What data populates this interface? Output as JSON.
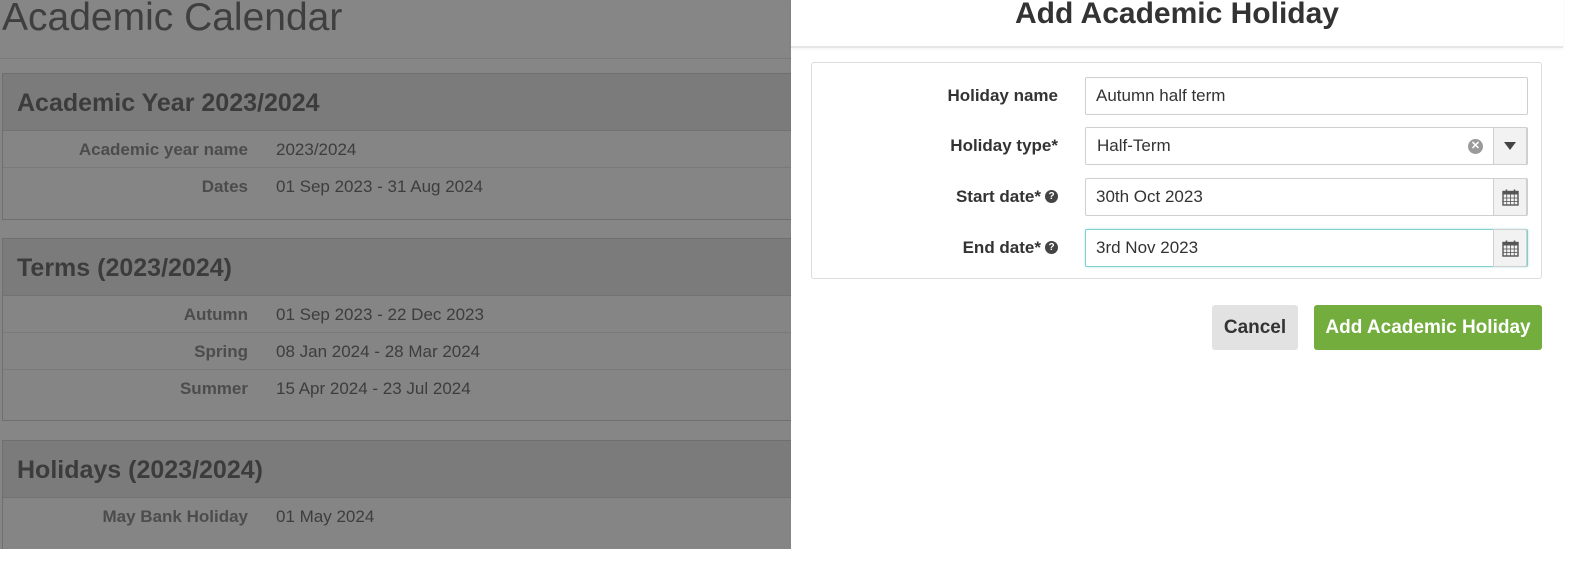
{
  "background": {
    "page_title": "Academic Calendar",
    "sections": [
      {
        "heading": "Academic Year 2023/2024",
        "rows": [
          {
            "label": "Academic year name",
            "value": "2023/2024"
          },
          {
            "label": "Dates",
            "value": "01 Sep 2023 - 31 Aug 2024"
          }
        ]
      },
      {
        "heading": "Terms (2023/2024)",
        "rows": [
          {
            "label": "Autumn",
            "value": "01 Sep 2023 - 22 Dec 2023"
          },
          {
            "label": "Spring",
            "value": "08 Jan 2024 - 28 Mar 2024"
          },
          {
            "label": "Summer",
            "value": "15 Apr 2024 - 23 Jul 2024"
          }
        ]
      },
      {
        "heading": "Holidays (2023/2024)",
        "rows": [
          {
            "label": "May Bank Holiday",
            "value": "01 May 2024"
          }
        ]
      }
    ]
  },
  "modal": {
    "title": "Add Academic Holiday",
    "fields": {
      "holiday_name": {
        "label": "Holiday name",
        "value": "Autumn half term"
      },
      "holiday_type": {
        "label": "Holiday type*",
        "value": "Half-Term",
        "clear_icon": "times-circle-icon",
        "caret_icon": "caret-down-icon"
      },
      "start_date": {
        "label": "Start date*",
        "value": "30th Oct 2023",
        "help_icon": "?",
        "addon_icon": "calendar-icon"
      },
      "end_date": {
        "label": "End date*",
        "value": "3rd Nov 2023",
        "help_icon": "?",
        "addon_icon": "calendar-icon"
      }
    },
    "buttons": {
      "cancel": "Cancel",
      "submit": "Add Academic Holiday"
    }
  },
  "colors": {
    "primary_button": "#73ad3d",
    "focus_border": "#7fd1d1",
    "overlay": "#868686"
  }
}
